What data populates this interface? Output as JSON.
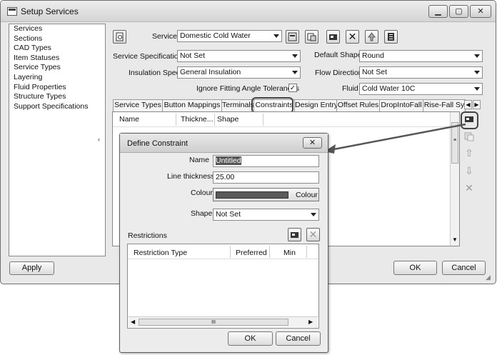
{
  "window": {
    "title": "Setup Services"
  },
  "sidebar": {
    "items": [
      "Services",
      "Sections",
      "CAD Types",
      "Item Statuses",
      "Service Types",
      "Layering",
      "Fluid Properties",
      "Structure Types",
      "Support Specifications"
    ]
  },
  "form": {
    "service_label": "Service",
    "service_value": "Domestic Cold Water",
    "service_spec_label": "Service Specification",
    "service_spec_value": "Not Set",
    "insulation_label": "Insulation Spec",
    "insulation_value": "General Insulation",
    "ignore_label": "Ignore Fitting Angle Tolerances",
    "ignore_checked": "✓",
    "default_shape_label": "Default Shape",
    "default_shape_value": "Round",
    "flow_label": "Flow Direction",
    "flow_value": "Not Set",
    "fluid_label": "Fluid",
    "fluid_value": "Cold Water 10C"
  },
  "tabs": [
    "Service Types",
    "Button Mappings",
    "Terminals",
    "Constraints",
    "Design Entry",
    "Offset Rules",
    "DropIntoFall",
    "Rise-Fall Sy"
  ],
  "grid": {
    "headers": [
      "Name",
      "Thickne...",
      "Shape"
    ]
  },
  "footer": {
    "apply": "Apply",
    "ok": "OK",
    "cancel": "Cancel"
  },
  "dialog": {
    "title": "Define Constraint",
    "name_label": "Name",
    "name_value": "Untitled",
    "thickness_label": "Line thickness",
    "thickness_value": "25.00",
    "colour_label": "Colour",
    "colour_button": "Colour",
    "shape_label": "Shape",
    "shape_value": "Not Set",
    "restrictions_label": "Restrictions",
    "headers": [
      "Restriction Type",
      "Preferred",
      "Min"
    ],
    "scroll_glyph": "III",
    "ok": "OK",
    "cancel": "Cancel"
  }
}
